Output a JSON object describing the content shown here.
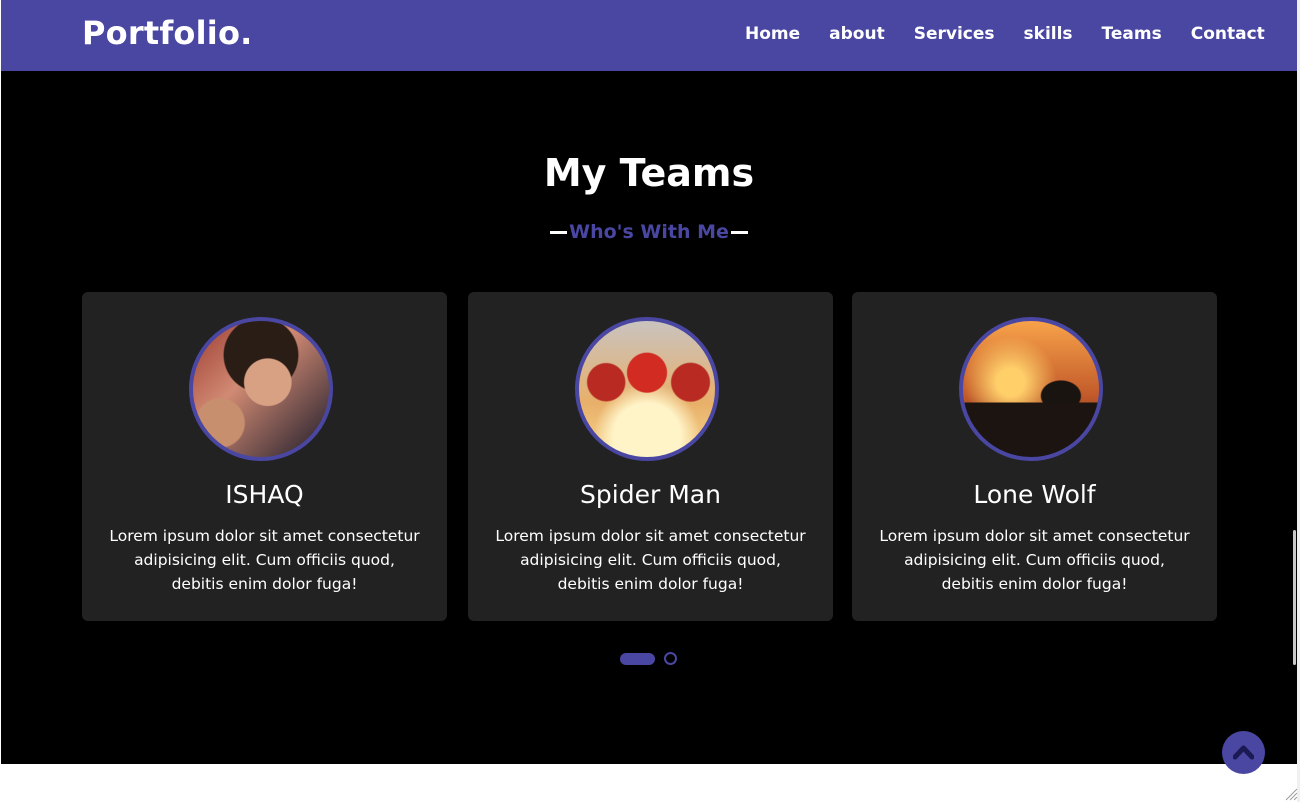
{
  "navbar": {
    "logo": "Portfolio.",
    "links": [
      "Home",
      "about",
      "Services",
      "skills",
      "Teams",
      "Contact"
    ]
  },
  "teams": {
    "title": "My Teams",
    "subtitle": "Who's With Me",
    "members": [
      {
        "name": "ISHAQ",
        "description": "Lorem ipsum dolor sit amet consectetur adipisicing elit. Cum officiis quod, debitis enim dolor fuga!",
        "avatar": "boy-portrait-photo"
      },
      {
        "name": "Spider Man",
        "description": "Lorem ipsum dolor sit amet consectetur adipisicing elit. Cum officiis quod, debitis enim dolor fuga!",
        "avatar": "spider-man-photo"
      },
      {
        "name": "Lone Wolf",
        "description": "Lorem ipsum dolor sit amet consectetur adipisicing elit. Cum officiis quod, debitis enim dolor fuga!",
        "avatar": "city-sunset-silhouette-photo"
      }
    ],
    "pagination": {
      "pages": 2,
      "active": 1
    }
  },
  "icons": {
    "scroll_top": "chevron-up-icon"
  },
  "colors": {
    "accent": "#4a47a3",
    "section_bg": "#000000",
    "card_bg": "#222222",
    "text": "#ffffff"
  }
}
